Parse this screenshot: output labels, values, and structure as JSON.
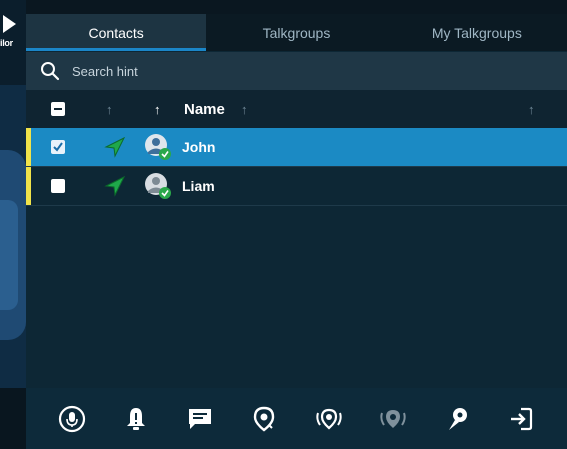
{
  "side_app": {
    "label": "ilor"
  },
  "tabs": [
    {
      "label": "Contacts",
      "active": true
    },
    {
      "label": "Talkgroups",
      "active": false
    },
    {
      "label": "My Talkgroups",
      "active": false
    }
  ],
  "search": {
    "placeholder": "Search hint",
    "value": ""
  },
  "table": {
    "name_header": "Name",
    "sort_arrow": "↑",
    "rows": [
      {
        "name": "John",
        "checked": true,
        "selected": true
      },
      {
        "name": "Liam",
        "checked": false,
        "selected": false
      }
    ]
  },
  "toolbar": {
    "icons": [
      "microphone-icon",
      "alert-bell-icon",
      "message-icon",
      "location-pin-icon",
      "location-radar-icon",
      "location-share-icon",
      "map-marker-icon",
      "sign-in-icon"
    ]
  },
  "colors": {
    "accent": "#1b86c8",
    "selected_row": "#1b8ac4",
    "status_bar": "#f0e34a",
    "online_green": "#2aa84a"
  }
}
